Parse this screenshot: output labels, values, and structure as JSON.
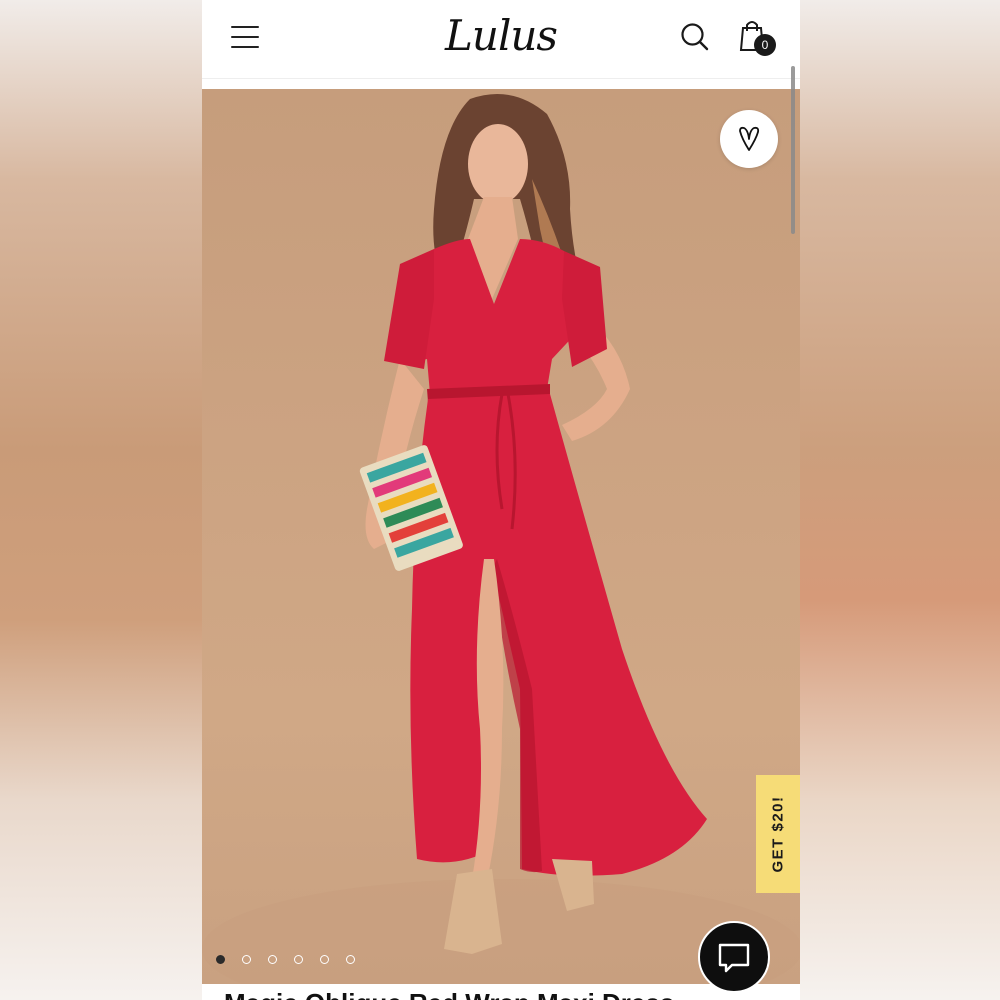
{
  "header": {
    "logo_text": "Lulus",
    "cart_count": "0"
  },
  "icons": {
    "menu": "hamburger-menu-icon",
    "search": "search-icon",
    "cart": "shopping-bag-icon",
    "wishlist": "heart-icon",
    "chat": "chat-bubble-icon"
  },
  "product": {
    "image_alt": "Model wearing red short-sleeve wrap maxi dress holding a beaded clutch",
    "title": "Magic Oblique Red Wrap Maxi Dress",
    "dress_color": "#d8203f",
    "background_color": "#c9a07f"
  },
  "carousel": {
    "total_slides": 6,
    "active_index": 0
  },
  "promo": {
    "label": "GET $20!",
    "color": "#f6dc77"
  }
}
